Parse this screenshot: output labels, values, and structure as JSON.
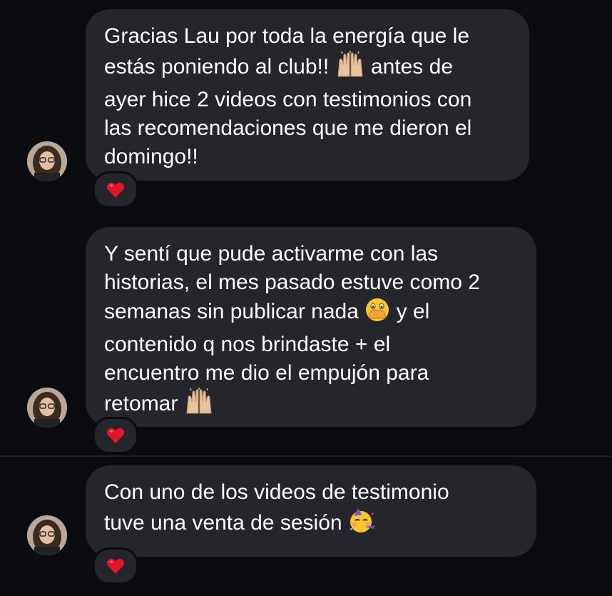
{
  "messages": [
    {
      "lines": [
        "Gracias Lau por toda la energía que le",
        "estás poniendo al club!!",
        "antes de",
        "ayer hice 2 videos con testimonios con",
        "las recomendaciones que me dieron el",
        "domingo!!"
      ],
      "reaction": "heart-emoji"
    },
    {
      "lines": [
        "Y sentí que pude activarme con las",
        "historias, el mes pasado estuve como 2",
        "semanas sin publicar nada",
        "y el",
        "contenido q nos brindaste + el",
        "encuentro me dio el empujón para",
        "retomar"
      ],
      "reaction": "heart-emoji"
    },
    {
      "lines": [
        "Con uno de los videos de testimonio",
        "tuve una venta de sesión"
      ],
      "reaction": "heart-emoji"
    }
  ],
  "colors": {
    "background": "#0b0c10",
    "bubble": "#25262b",
    "text": "#ffffff",
    "heart": "#e0162b"
  }
}
